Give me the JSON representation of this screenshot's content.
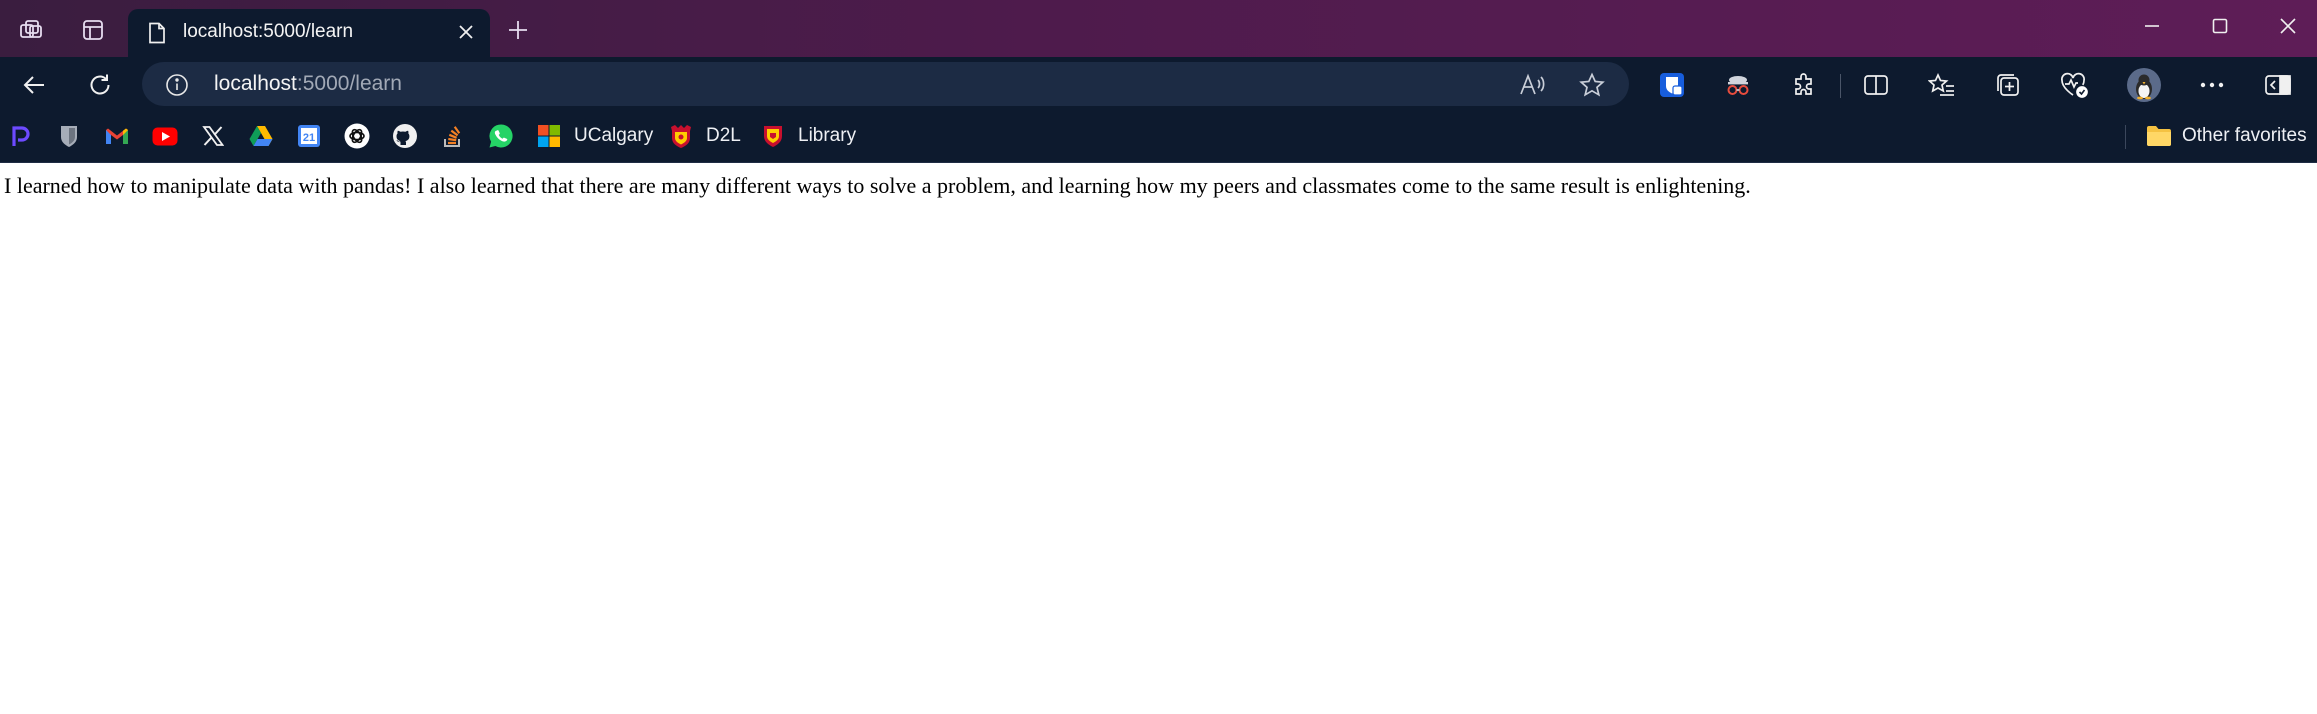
{
  "browser": {
    "tab": {
      "title": "localhost:5000/learn"
    },
    "address": {
      "host": "localhost",
      "path": ":5000/learn"
    },
    "bookmarks": [
      {
        "label": "",
        "icon": "proton-pass-icon"
      },
      {
        "label": "",
        "icon": "bitwarden-shield-icon"
      },
      {
        "label": "",
        "icon": "gmail-icon"
      },
      {
        "label": "",
        "icon": "youtube-icon"
      },
      {
        "label": "",
        "icon": "x-icon"
      },
      {
        "label": "",
        "icon": "google-drive-icon"
      },
      {
        "label": "",
        "icon": "google-calendar-icon",
        "badge": "21"
      },
      {
        "label": "",
        "icon": "chatgpt-icon"
      },
      {
        "label": "",
        "icon": "github-icon"
      },
      {
        "label": "",
        "icon": "stackoverflow-icon"
      },
      {
        "label": "",
        "icon": "whatsapp-icon"
      },
      {
        "label": "UCalgary",
        "icon": "microsoft-icon"
      },
      {
        "label": "D2L",
        "icon": "ucalgary-crest-icon"
      },
      {
        "label": "Library",
        "icon": "ucalgary-shield-icon"
      }
    ],
    "other_favorites": "Other favorites",
    "colors": {
      "titlebar": "#4e1b4c",
      "toolbar": "#0d1a2e",
      "omnibox": "#1c2b44"
    }
  },
  "page": {
    "text": "I learned how to manipulate data with pandas! I also learned that there are many different ways to solve a problem, and learning how my peers and classmates come to the same result is enlightening."
  }
}
